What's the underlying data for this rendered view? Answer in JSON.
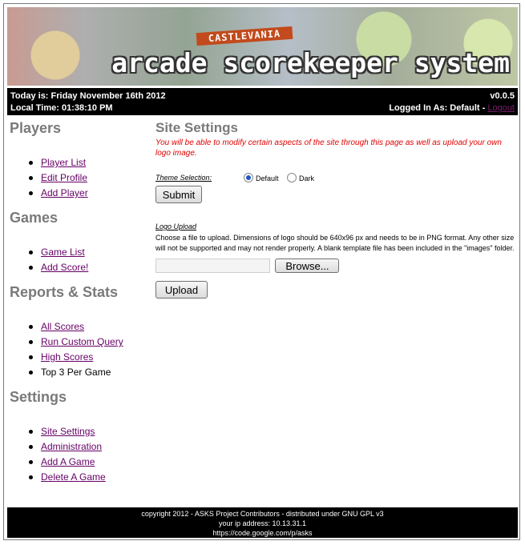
{
  "banner": {
    "title": "arcade scorekeeper system",
    "ribbon_text": "CASTLEVANIA"
  },
  "infobar": {
    "today": "Today is: Friday November 16th 2012",
    "local_time": "Local Time: 01:38:10 PM",
    "version": "v0.0.5",
    "logged_in": "Logged In As: Default - ",
    "logout": "Logout"
  },
  "sidebar": {
    "players": {
      "heading": "Players",
      "items": [
        "Player List",
        "Edit Profile",
        "Add Player"
      ]
    },
    "games": {
      "heading": "Games",
      "items": [
        "Game List",
        "Add Score!"
      ]
    },
    "reports": {
      "heading": "Reports & Stats",
      "items": [
        "All Scores",
        "Run Custom Query",
        "High Scores"
      ],
      "current": "Top 3 Per Game"
    },
    "settings": {
      "heading": "Settings",
      "items": [
        "Site Settings",
        "Administration",
        "Add A Game",
        "Delete A Game"
      ]
    }
  },
  "main": {
    "title": "Site Settings",
    "description": "You will be able to modify certain aspects of the site through this page as well as upload your own logo image.",
    "theme": {
      "label": "Theme Selection:",
      "options": [
        "Default",
        "Dark"
      ],
      "selected": "Default",
      "submit": "Submit"
    },
    "logo": {
      "label": "Logo Upload",
      "text": "Choose a file to upload. Dimensions of logo should be 640x96 px and needs to be in PNG format. Any other size will not be supported and may not render properly. A blank template file has been included in the \"images\" folder.",
      "browse": "Browse...",
      "upload": "Upload"
    }
  },
  "footer": {
    "line1": "copyright 2012 - ASKS Project Contributors - distributed under GNU GPL v3",
    "line2": "your ip address: 10.13.31.1",
    "line3": "https://code.google.com/p/asks"
  }
}
